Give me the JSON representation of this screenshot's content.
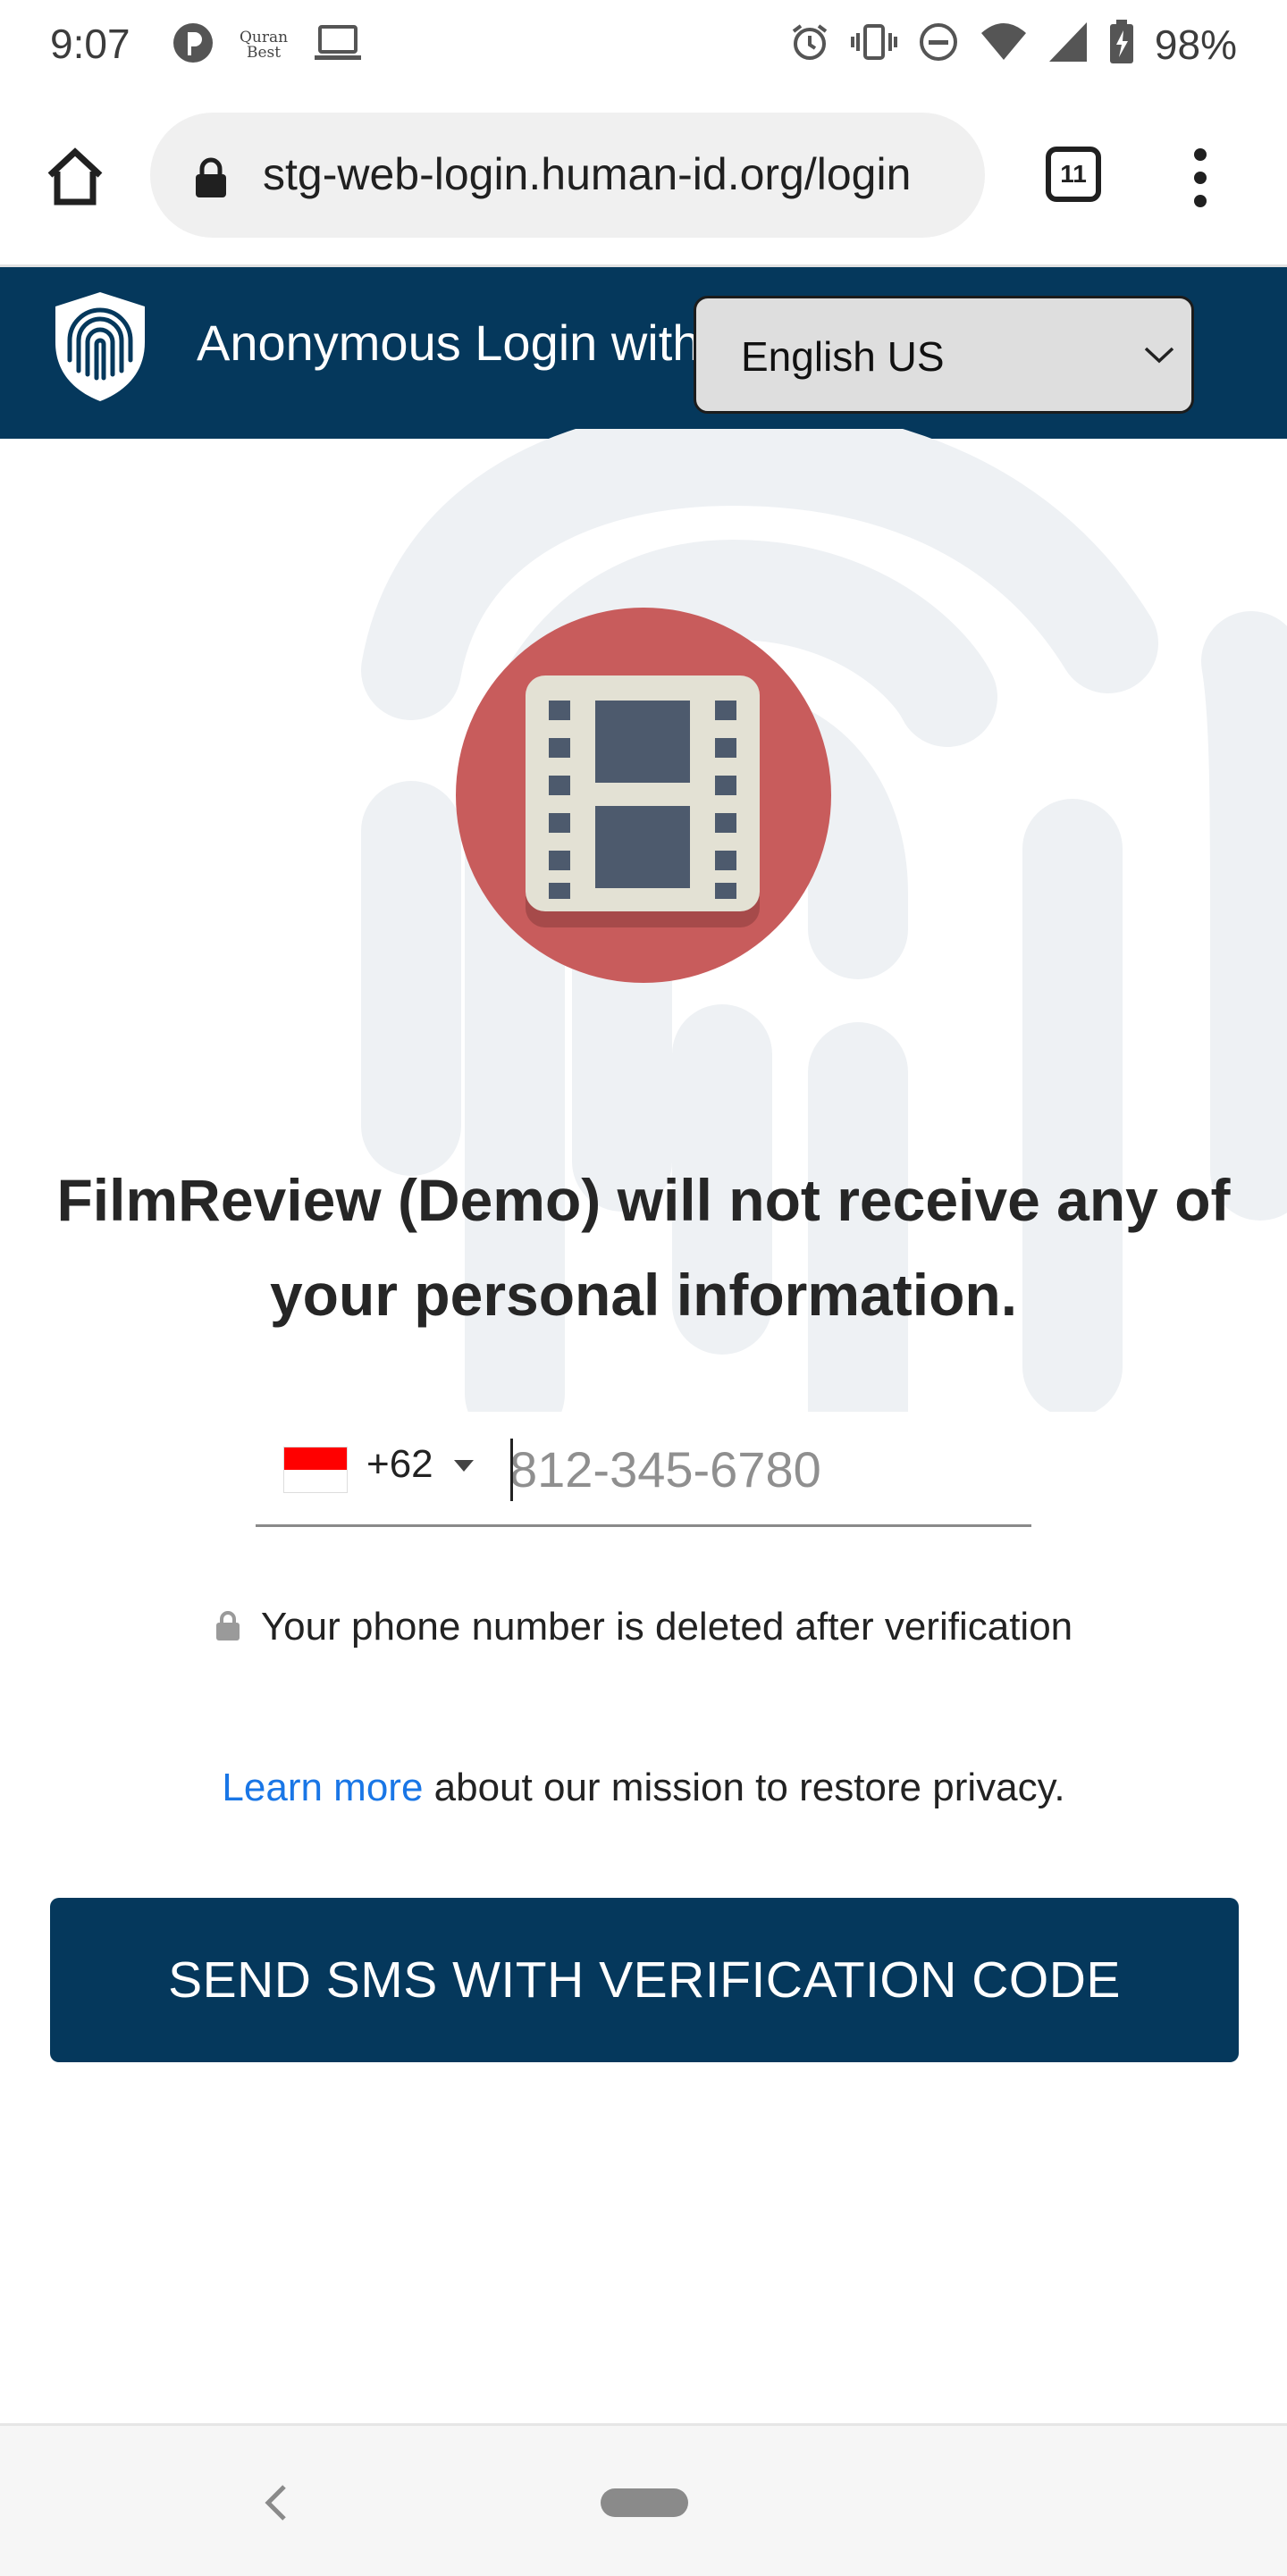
{
  "status_bar": {
    "time": "9:07",
    "quran_top": "Quran",
    "quran_bottom": "Best",
    "battery": "98%",
    "icons": [
      "app-icon",
      "quran-best-icon",
      "laptop-icon",
      "alarm-icon",
      "vibrate-icon",
      "do-not-disturb-icon",
      "wifi-icon",
      "signal-icon",
      "battery-charging-icon"
    ]
  },
  "browser": {
    "url": "stg-web-login.human-id.org/login",
    "tab_count": "11"
  },
  "header": {
    "title": "Anonymous Login with humanID",
    "language": "English US"
  },
  "main": {
    "headline": "FilmReview (Demo) will not receive any of your personal information.",
    "dial_code": "+62",
    "phone_placeholder": "812-345-6780",
    "privacy_note": "Your phone number is deleted after verification",
    "learn_more": "Learn more",
    "mission_text": " about our mission to restore privacy.",
    "send_button": "SEND SMS WITH VERIFICATION CODE"
  },
  "colors": {
    "brand_navy": "#05385c",
    "film_circle": "#c85c5c",
    "link_blue": "#1976e6"
  }
}
